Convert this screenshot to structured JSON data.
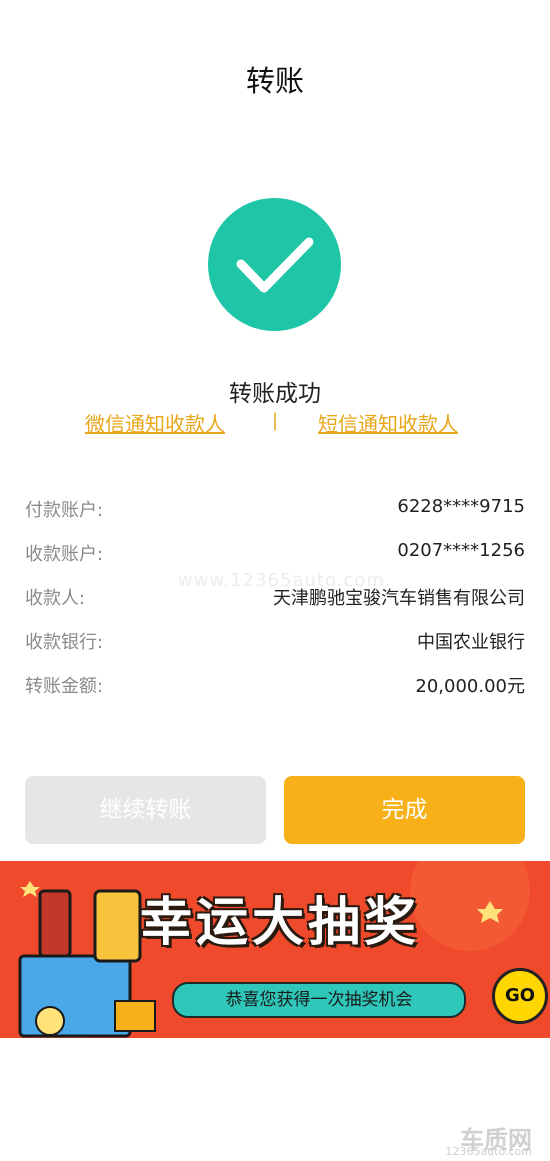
{
  "header": {
    "title": "转账"
  },
  "result": {
    "status": "转账成功"
  },
  "notify": {
    "wechat_label": "微信通知收款人",
    "separator": "|",
    "sms_label": "短信通知收款人"
  },
  "details": {
    "payer_account": {
      "label": "付款账户:",
      "value": "6228****9715"
    },
    "payee_account": {
      "label": "收款账户:",
      "value": "0207****1256"
    },
    "payee_name": {
      "label": "收款人:",
      "value": "天津鹏驰宝骏汽车销售有限公司"
    },
    "payee_bank": {
      "label": "收款银行:",
      "value": "中国农业银行"
    },
    "amount": {
      "label": "转账金额:",
      "value": "20,000.00元"
    }
  },
  "buttons": {
    "continue_label": "继续转账",
    "done_label": "完成"
  },
  "banner": {
    "headline": "幸运大抽奖",
    "subline": "恭喜您获得一次抽奖机会",
    "go_label": "GO"
  },
  "watermark": {
    "text": "www.12365auto.com"
  },
  "footer": {
    "logo": "车质网",
    "url": "12365auto.com"
  },
  "colors": {
    "success": "#1ec5a6",
    "accent": "#f7b018",
    "link": "#e8a61a",
    "banner": "#f04a2c"
  }
}
